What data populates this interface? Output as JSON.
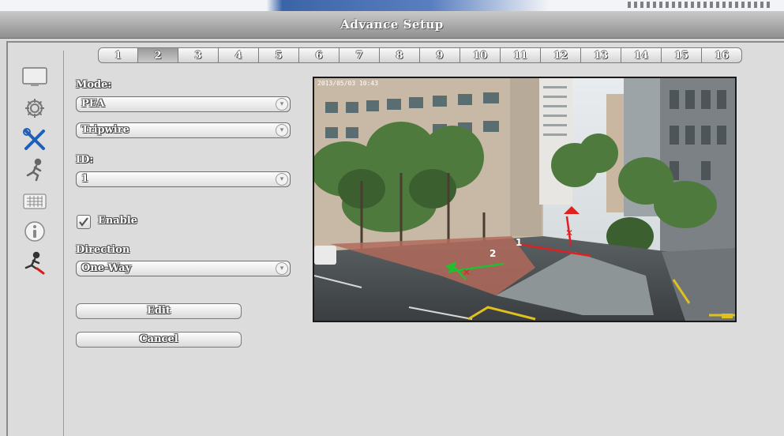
{
  "window": {
    "title": "Advance Setup"
  },
  "channel_tabs": [
    "1",
    "2",
    "3",
    "4",
    "5",
    "6",
    "7",
    "8",
    "9",
    "10",
    "11",
    "12",
    "13",
    "14",
    "15",
    "16"
  ],
  "active_channel": "2",
  "sidebar_icons": [
    "monitor-icon",
    "gear-icon",
    "tools-icon",
    "running-man-icon",
    "keyboard-icon",
    "info-icon",
    "motion-person-icon"
  ],
  "form": {
    "mode_label": "Mode:",
    "mode_value": "PEA",
    "pea_type_value": "Tripwire",
    "id_label": "ID:",
    "id_value": "1",
    "enable_label": "Enable",
    "enable_checked": true,
    "direction_label": "Direction",
    "direction_value": "One-Way"
  },
  "buttons": {
    "edit": "Edit",
    "cancel": "Cancel"
  },
  "preview": {
    "timestamp": "2013/05/03 10:43",
    "tripwire_labels": [
      "1",
      "2"
    ],
    "colors": {
      "tripwire_1": "#e02020",
      "tripwire_2": "#20c030"
    }
  }
}
